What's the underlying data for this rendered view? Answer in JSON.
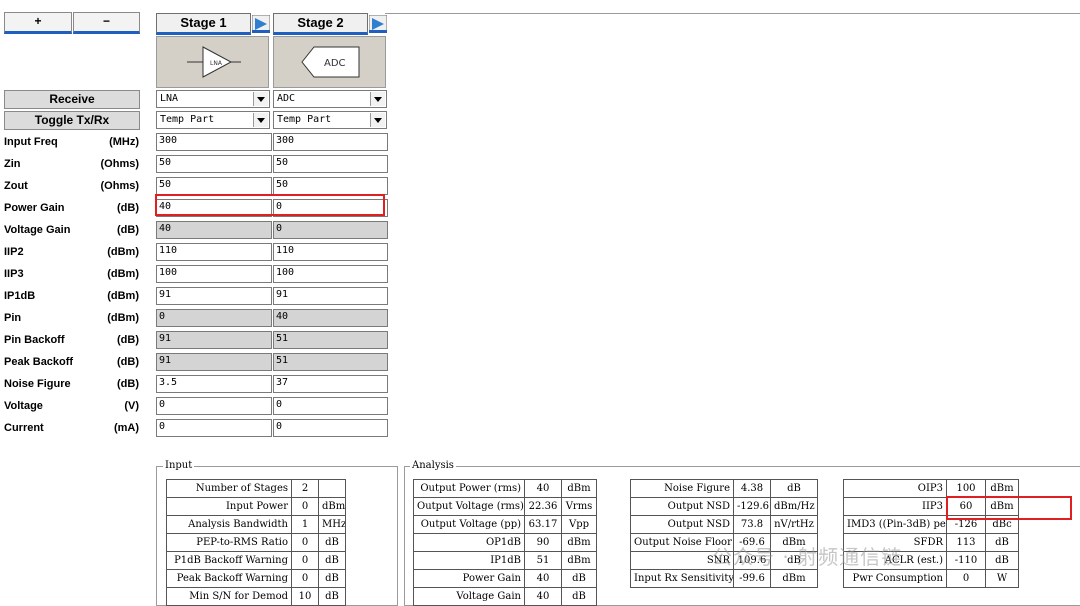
{
  "toolbar": {
    "plus_label": "+",
    "minus_label": "−"
  },
  "side_buttons": {
    "receive_label": "Receive",
    "toggle_label": "Toggle Tx/Rx"
  },
  "rows": [
    {
      "label": "Input Freq",
      "unit": "(MHz)"
    },
    {
      "label": "Zin",
      "unit": "(Ohms)"
    },
    {
      "label": "Zout",
      "unit": "(Ohms)"
    },
    {
      "label": "Power Gain",
      "unit": "(dB)"
    },
    {
      "label": "Voltage Gain",
      "unit": "(dB)"
    },
    {
      "label": "IIP2",
      "unit": "(dBm)"
    },
    {
      "label": "IIP3",
      "unit": "(dBm)"
    },
    {
      "label": "IP1dB",
      "unit": "(dBm)"
    },
    {
      "label": "Pin",
      "unit": "(dBm)"
    },
    {
      "label": "Pin Backoff",
      "unit": "(dB)"
    },
    {
      "label": "Peak Backoff",
      "unit": "(dB)"
    },
    {
      "label": "Noise Figure",
      "unit": "(dB)"
    },
    {
      "label": "Voltage",
      "unit": "(V)"
    },
    {
      "label": "Current",
      "unit": "(mA)"
    }
  ],
  "stages": [
    {
      "header": "Stage 1",
      "icon_text": "LNA",
      "part": "LNA",
      "part_type": "Temp Part",
      "values": [
        "300",
        "50",
        "50",
        "40",
        "40",
        "110",
        "100",
        "91",
        "0",
        "91",
        "91",
        "3.5",
        "0",
        "0"
      ]
    },
    {
      "header": "Stage 2",
      "icon_text": "ADC",
      "part": "ADC",
      "part_type": "Temp Part",
      "values": [
        "300",
        "50",
        "50",
        "0",
        "0",
        "110",
        "100",
        "91",
        "40",
        "51",
        "51",
        "37",
        "0",
        "0"
      ]
    }
  ],
  "gray_rows": [
    4,
    8,
    9,
    10
  ],
  "input_group": {
    "title": "Input",
    "rows": [
      {
        "label": "Number of Stages",
        "value": "2",
        "unit": ""
      },
      {
        "label": "Input Power",
        "value": "0",
        "unit": "dBm"
      },
      {
        "label": "Analysis Bandwidth",
        "value": "1",
        "unit": "MHz"
      },
      {
        "label": "PEP-to-RMS Ratio",
        "value": "0",
        "unit": "dB"
      },
      {
        "label": "P1dB Backoff Warning",
        "value": "0",
        "unit": "dB"
      },
      {
        "label": "Peak Backoff Warning",
        "value": "0",
        "unit": "dB"
      },
      {
        "label": "Min S/N for Demod",
        "value": "10",
        "unit": "dB"
      }
    ]
  },
  "analysis_group": {
    "title": "Analysis",
    "col1": [
      {
        "label": "Output Power (rms)",
        "value": "40",
        "unit": "dBm"
      },
      {
        "label": "Output Voltage (rms)",
        "value": "22.36",
        "unit": "Vrms"
      },
      {
        "label": "Output Voltage (pp)",
        "value": "63.17",
        "unit": "Vpp"
      },
      {
        "label": "OP1dB",
        "value": "90",
        "unit": "dBm"
      },
      {
        "label": "IP1dB",
        "value": "51",
        "unit": "dBm"
      },
      {
        "label": "Power Gain",
        "value": "40",
        "unit": "dB"
      },
      {
        "label": "Voltage Gain",
        "value": "40",
        "unit": "dB"
      }
    ],
    "col2": [
      {
        "label": "Noise Figure",
        "value": "4.38",
        "unit": "dB"
      },
      {
        "label": "Output NSD",
        "value": "-129.6",
        "unit": "dBm/Hz"
      },
      {
        "label": "Output NSD",
        "value": "73.8",
        "unit": "nV/rtHz"
      },
      {
        "label": "Output Noise Floor",
        "value": "-69.6",
        "unit": "dBm"
      },
      {
        "label": "SNR",
        "value": "109.6",
        "unit": "dB"
      },
      {
        "label": "Input Rx Sensitivity",
        "value": "-99.6",
        "unit": "dBm"
      }
    ],
    "col3": [
      {
        "label": "OIP3",
        "value": "100",
        "unit": "dBm"
      },
      {
        "label": "IIP3",
        "value": "60",
        "unit": "dBm"
      },
      {
        "label": "IMD3 ((Pin-3dB) per tone)",
        "value": "-126",
        "unit": "dBc"
      },
      {
        "label": "SFDR",
        "value": "113",
        "unit": "dB"
      },
      {
        "label": "ACLR (est.)",
        "value": "-110",
        "unit": "dB"
      },
      {
        "label": "Pwr Consumption",
        "value": "0",
        "unit": "W"
      }
    ]
  },
  "watermark": "公众号 · 射频通信链",
  "colors": {
    "highlight": "#e02020",
    "accent": "#1f5fbf",
    "gray_field": "#d4d4d4"
  }
}
